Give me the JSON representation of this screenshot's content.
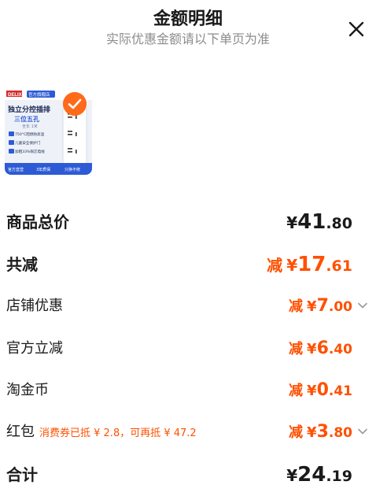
{
  "header": {
    "title": "金额明细",
    "subtitle": "实际优惠金额请以下单页为准"
  },
  "product": {
    "brand": "DELIXI",
    "badge": "官方旗舰店",
    "name_line1": "独立分控插排",
    "name_line2": "三位五孔",
    "spec": "全长 1米",
    "features": [
      "750°C阻燃防高温",
      "儿童安全保护门",
      "加粗33%铜芯电线"
    ],
    "footer_tags": [
      "官方直营",
      "3年质保",
      "只换不修"
    ]
  },
  "rows": {
    "total": {
      "label": "商品总价",
      "yen": "¥",
      "int": "41",
      "dec": ".80"
    },
    "discount_total": {
      "label": "共减",
      "prefix": "减",
      "yen": "¥",
      "int": "17",
      "dec": ".61"
    },
    "shop": {
      "label": "店铺优惠",
      "prefix": "减",
      "yen": "¥",
      "int": "7",
      "dec": ".00"
    },
    "official": {
      "label": "官方立减",
      "prefix": "减",
      "yen": "¥",
      "int": "6",
      "dec": ".40"
    },
    "coins": {
      "label": "淘金币",
      "prefix": "减",
      "yen": "¥",
      "int": "0",
      "dec": ".41"
    },
    "redpacket": {
      "label": "红包",
      "note": "消费券已抵 ¥ 2.8，可再抵 ¥ 47.2",
      "prefix": "减",
      "yen": "¥",
      "int": "3",
      "dec": ".80"
    },
    "sum": {
      "label": "合计",
      "yen": "¥",
      "int": "24",
      "dec": ".19"
    }
  },
  "colors": {
    "accent": "#ff5000",
    "text": "#1a1a1a",
    "muted": "#8c8c8c",
    "brand_blue": "#2d5bd6"
  }
}
